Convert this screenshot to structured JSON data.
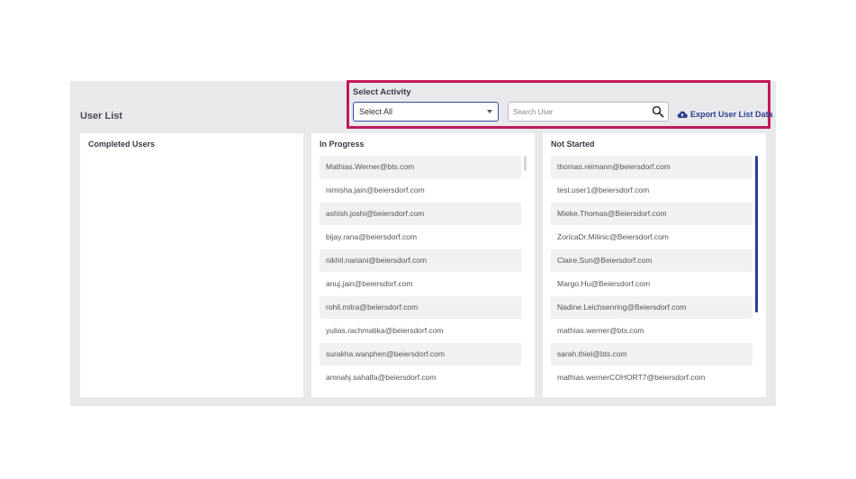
{
  "header": {
    "title": "User List",
    "activity_label": "Select Activity",
    "select_value": "Select All",
    "search_placeholder": "Search User",
    "export_label": "Export User List Data"
  },
  "columns": {
    "completed": {
      "title": "Completed Users",
      "items": []
    },
    "in_progress": {
      "title": "In Progress",
      "items": [
        "Mathias.Werner@bts.com",
        "nimisha.jain@beiersdorf.com",
        "ashish.joshi@beiersdorf.com",
        "bijay.rana@beiersdorf.com",
        "nikhil.nariani@beiersdorf.com",
        "anuj.jain@beiersdorf.com",
        "rohil.mitra@beiersdorf.com",
        "yulias.rachmatika@beiersdorf.com",
        "surakha.wanphen@beiersdorf.com",
        "amnahj.sahalfa@beiersdorf.com"
      ]
    },
    "not_started": {
      "title": "Not Started",
      "items": [
        "thomas.reimann@beiersdorf.com",
        "test.user1@beiersdorf.com",
        "Mieke.Thomas@Beiersdorf.com",
        "ZoricaDr.Milinic@Beiersdorf.com",
        "Claire.Sun@Beiersdorf.com",
        "Margo.Hu@Beiersdorf.com",
        "Nadine.Leichsenring@Beiersdorf.com",
        "mathias.werner@bts.com",
        "sarah.thiel@bts.com",
        "mathias.wernerCOHORT7@beiersdorf.com"
      ]
    }
  },
  "colors": {
    "highlight": "#c2185b",
    "accent": "#2a3f8f"
  },
  "icons": {
    "search": "search-icon",
    "caret": "chevron-down-icon",
    "export": "cloud-upload-icon"
  }
}
